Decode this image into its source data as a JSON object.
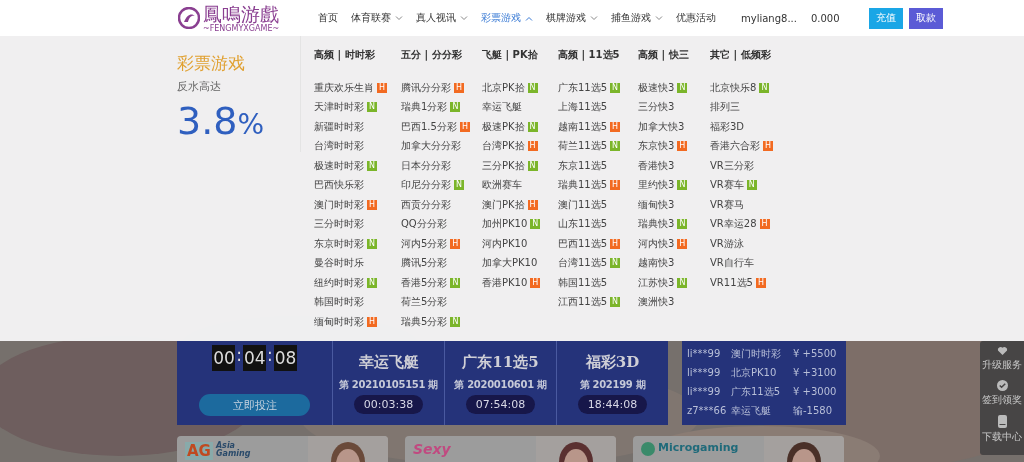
{
  "header": {
    "logo": {
      "name": "鳳鳴游戲",
      "tagline": "~FENGMYXGAME~"
    },
    "nav": [
      {
        "label": "首页",
        "has_menu": false,
        "selected": false
      },
      {
        "label": "体育联赛",
        "has_menu": true,
        "selected": false
      },
      {
        "label": "真人视讯",
        "has_menu": true,
        "selected": false
      },
      {
        "label": "彩票游戏",
        "has_menu": true,
        "selected": true
      },
      {
        "label": "棋牌游戏",
        "has_menu": true,
        "selected": false
      },
      {
        "label": "捕鱼游戏",
        "has_menu": true,
        "selected": false
      },
      {
        "label": "优惠活动",
        "has_menu": false,
        "selected": false
      }
    ],
    "user": "myliang8...",
    "balance": "0.000",
    "buttons": [
      {
        "label": "充值",
        "kind": "deposit"
      },
      {
        "label": "取款",
        "kind": "withdraw"
      }
    ]
  },
  "menu": {
    "title": "彩票游戏",
    "subtitle": "反水高达",
    "rate": "3.8",
    "unit": "%",
    "columns": [
      {
        "heading": "高频 | 时时彩",
        "items": [
          {
            "label": "重庆欢乐生肖",
            "tag": {
              "text": "H",
              "color": "#f26a21"
            }
          },
          {
            "label": "天津时时彩",
            "tag": {
              "text": "N",
              "color": "#7bb52a"
            }
          },
          {
            "label": "新疆时时彩"
          },
          {
            "label": "台湾时时彩"
          },
          {
            "label": "极速时时彩",
            "tag": {
              "text": "N",
              "color": "#7bb52a"
            }
          },
          {
            "label": "巴西快乐彩"
          },
          {
            "label": "澳门时时彩",
            "tag": {
              "text": "H",
              "color": "#f26a21"
            }
          },
          {
            "label": "三分时时彩"
          },
          {
            "label": "东京时时彩",
            "tag": {
              "text": "N",
              "color": "#7bb52a"
            }
          },
          {
            "label": "曼谷时时乐"
          },
          {
            "label": "纽约时时彩",
            "tag": {
              "text": "N",
              "color": "#7bb52a"
            }
          },
          {
            "label": "韩国时时彩"
          },
          {
            "label": "缅甸时时彩",
            "tag": {
              "text": "H",
              "color": "#f26a21"
            }
          }
        ]
      },
      {
        "heading": "五分 | 分分彩",
        "items": [
          {
            "label": "腾讯分分彩",
            "tag": {
              "text": "H",
              "color": "#f26a21"
            }
          },
          {
            "label": "瑞典1分彩",
            "tag": {
              "text": "N",
              "color": "#7bb52a"
            }
          },
          {
            "label": "巴西1.5分彩",
            "tag": {
              "text": "H",
              "color": "#f26a21"
            }
          },
          {
            "label": "加拿大分分彩"
          },
          {
            "label": "日本分分彩"
          },
          {
            "label": "印尼分分彩",
            "tag": {
              "text": "N",
              "color": "#7bb52a"
            }
          },
          {
            "label": "西贡分分彩"
          },
          {
            "label": "QQ分分彩"
          },
          {
            "label": "河内5分彩",
            "tag": {
              "text": "H",
              "color": "#f26a21"
            }
          },
          {
            "label": "腾讯5分彩"
          },
          {
            "label": "香港5分彩",
            "tag": {
              "text": "N",
              "color": "#7bb52a"
            }
          },
          {
            "label": "荷兰5分彩"
          },
          {
            "label": "瑞典5分彩",
            "tag": {
              "text": "N",
              "color": "#7bb52a"
            }
          }
        ]
      },
      {
        "heading": "飞艇 | PK拾",
        "items": [
          {
            "label": "北京PK拾",
            "tag": {
              "text": "N",
              "color": "#7bb52a"
            }
          },
          {
            "label": "幸运飞艇"
          },
          {
            "label": "极速PK拾",
            "tag": {
              "text": "N",
              "color": "#7bb52a"
            }
          },
          {
            "label": "台湾PK拾",
            "tag": {
              "text": "H",
              "color": "#f26a21"
            }
          },
          {
            "label": "三分PK拾",
            "tag": {
              "text": "N",
              "color": "#7bb52a"
            }
          },
          {
            "label": "欧洲赛车"
          },
          {
            "label": "澳门PK拾",
            "tag": {
              "text": "H",
              "color": "#f26a21"
            }
          },
          {
            "label": "加州PK10",
            "tag": {
              "text": "N",
              "color": "#7bb52a"
            }
          },
          {
            "label": "河内PK10"
          },
          {
            "label": "加拿大PK10"
          },
          {
            "label": "香港PK10",
            "tag": {
              "text": "H",
              "color": "#f26a21"
            }
          }
        ]
      },
      {
        "heading": "高频 | 11选5",
        "items": [
          {
            "label": "广东11选5",
            "tag": {
              "text": "N",
              "color": "#7bb52a"
            }
          },
          {
            "label": "上海11选5"
          },
          {
            "label": "越南11选5",
            "tag": {
              "text": "H",
              "color": "#f26a21"
            }
          },
          {
            "label": "荷兰11选5",
            "tag": {
              "text": "N",
              "color": "#7bb52a"
            }
          },
          {
            "label": "东京11选5"
          },
          {
            "label": "瑞典11选5",
            "tag": {
              "text": "H",
              "color": "#f26a21"
            }
          },
          {
            "label": "澳门11选5"
          },
          {
            "label": "山东11选5"
          },
          {
            "label": "巴西11选5",
            "tag": {
              "text": "H",
              "color": "#f26a21"
            }
          },
          {
            "label": "台湾11选5",
            "tag": {
              "text": "N",
              "color": "#7bb52a"
            }
          },
          {
            "label": "韩国11选5"
          },
          {
            "label": "江西11选5",
            "tag": {
              "text": "N",
              "color": "#7bb52a"
            }
          }
        ]
      },
      {
        "heading": "高频 | 快三",
        "items": [
          {
            "label": "极速快3",
            "tag": {
              "text": "N",
              "color": "#7bb52a"
            }
          },
          {
            "label": "三分快3"
          },
          {
            "label": "加拿大快3"
          },
          {
            "label": "东京快3",
            "tag": {
              "text": "H",
              "color": "#f26a21"
            }
          },
          {
            "label": "香港快3"
          },
          {
            "label": "里约快3",
            "tag": {
              "text": "N",
              "color": "#7bb52a"
            }
          },
          {
            "label": "缅甸快3"
          },
          {
            "label": "瑞典快3",
            "tag": {
              "text": "N",
              "color": "#7bb52a"
            }
          },
          {
            "label": "河内快3",
            "tag": {
              "text": "H",
              "color": "#f26a21"
            }
          },
          {
            "label": "越南快3"
          },
          {
            "label": "江苏快3",
            "tag": {
              "text": "N",
              "color": "#7bb52a"
            }
          },
          {
            "label": "澳洲快3"
          }
        ]
      },
      {
        "heading": "其它 | 低频彩",
        "items": [
          {
            "label": "北京快乐8",
            "tag": {
              "text": "N",
              "color": "#7bb52a"
            }
          },
          {
            "label": "排列三"
          },
          {
            "label": "福彩3D"
          },
          {
            "label": "香港六合彩",
            "tag": {
              "text": "H",
              "color": "#f26a21"
            }
          },
          {
            "label": "VR三分彩"
          },
          {
            "label": "VR赛车",
            "tag": {
              "text": "N",
              "color": "#7bb52a"
            }
          },
          {
            "label": "VR赛马"
          },
          {
            "label": "VR幸运28",
            "tag": {
              "text": "H",
              "color": "#f26a21"
            }
          },
          {
            "label": "VR游泳"
          },
          {
            "label": "VR自行车"
          },
          {
            "label": "VR11选5",
            "tag": {
              "text": "H",
              "color": "#f26a21"
            }
          }
        ]
      }
    ]
  },
  "countdown": {
    "digits": [
      "00",
      "04",
      "08"
    ],
    "separator": ":",
    "button": "立即投注"
  },
  "lotteries": [
    {
      "name": "幸运飞艇",
      "issue": "第 20210105151 期",
      "time": "00:03:38"
    },
    {
      "name": "广东11选5",
      "issue": "第 2020010601 期",
      "time": "07:54:08"
    },
    {
      "name": "福彩3D",
      "issue": "第 202199 期",
      "time": "18:44:08"
    }
  ],
  "winners": [
    {
      "user": "li***99",
      "game": "澳门时时彩",
      "amount": "¥ +5500"
    },
    {
      "user": "li***99",
      "game": "北京PK10",
      "amount": "¥ +3100"
    },
    {
      "user": "li***99",
      "game": "广东11选5",
      "amount": "¥ +3000"
    },
    {
      "user": "z7***66",
      "game": "幸运飞艇",
      "amount": "输-1580"
    }
  ],
  "providers": [
    {
      "kind": "ag",
      "mark": "AG",
      "name": [
        "Asia",
        "Gaming"
      ]
    },
    {
      "kind": "sexy",
      "name": [
        "Sexy"
      ]
    },
    {
      "kind": "mg",
      "name": [
        "Microgaming"
      ]
    }
  ],
  "side_bar": [
    {
      "label": "升级服务",
      "kind": "upgrade"
    },
    {
      "label": "签到领奖",
      "kind": "checkin"
    },
    {
      "label": "下载中心",
      "kind": "download"
    }
  ]
}
